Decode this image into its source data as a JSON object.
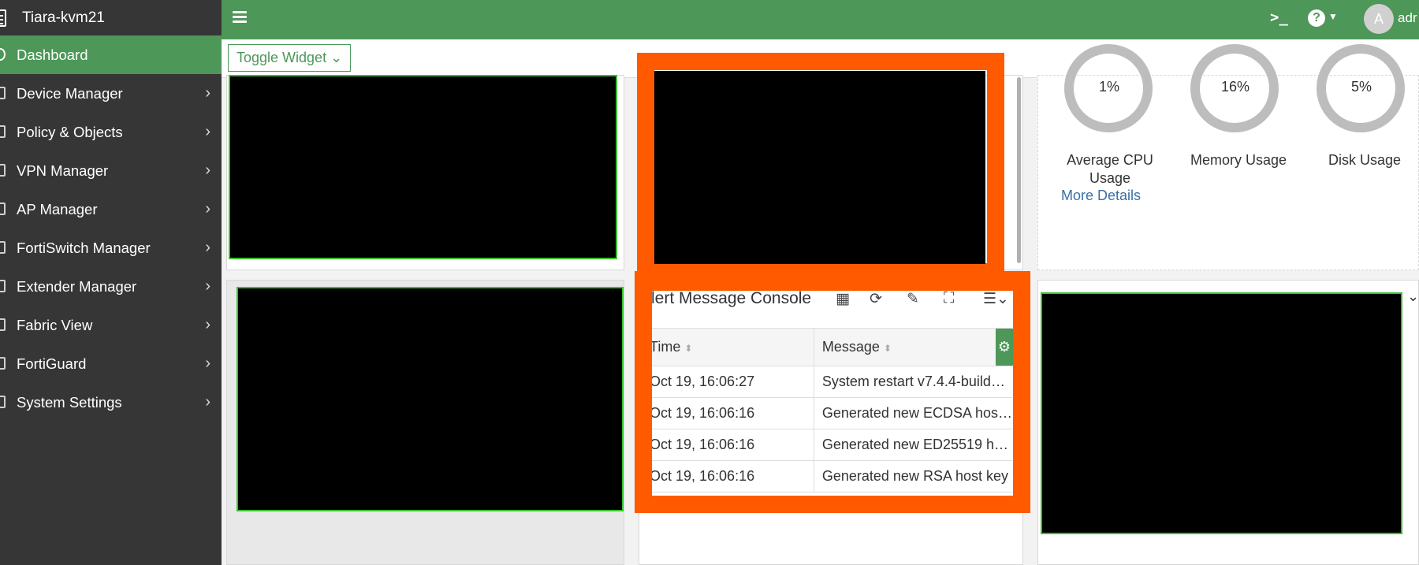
{
  "app": {
    "hostname": "Tiara-kvm21",
    "user": "adr",
    "avatar_letter": "A"
  },
  "sidebar": {
    "items": [
      {
        "label": "Dashboard",
        "active": true,
        "icon": "dashboard-icon"
      },
      {
        "label": "Device Manager",
        "icon": "device-manager-icon"
      },
      {
        "label": "Policy & Objects",
        "icon": "policy-icon"
      },
      {
        "label": "VPN Manager",
        "icon": "vpn-icon"
      },
      {
        "label": "AP Manager",
        "icon": "ap-icon"
      },
      {
        "label": "FortiSwitch Manager",
        "icon": "switch-icon"
      },
      {
        "label": "Extender Manager",
        "icon": "extender-icon"
      },
      {
        "label": "Fabric View",
        "icon": "fabric-icon"
      },
      {
        "label": "FortiGuard",
        "icon": "fortiguard-icon"
      },
      {
        "label": "System Settings",
        "icon": "gear-icon"
      }
    ]
  },
  "toolbar": {
    "toggle_widget": "Toggle Widget"
  },
  "resources": {
    "cpu": {
      "value": "1%",
      "label": "Average CPU Usage"
    },
    "memory": {
      "value": "16%",
      "label": "Memory Usage"
    },
    "disk": {
      "value": "5%",
      "label": "Disk Usage"
    },
    "more_details": "More Details"
  },
  "alert_console": {
    "title": "lert Message Console",
    "columns": [
      "Time",
      "Message"
    ],
    "rows": [
      {
        "time": "Oct 19, 16:06:27",
        "message": "System restart v7.4.4-build…"
      },
      {
        "time": "Oct 19, 16:06:16",
        "message": "Generated new ECDSA hos…"
      },
      {
        "time": "Oct 19, 16:06:16",
        "message": "Generated new ED25519 h…"
      },
      {
        "time": "Oct 19, 16:06:16",
        "message": "Generated new RSA host key"
      }
    ]
  },
  "colors": {
    "accent": "#4d9758",
    "sidebar": "#363636",
    "highlight": "#ff5a00"
  }
}
